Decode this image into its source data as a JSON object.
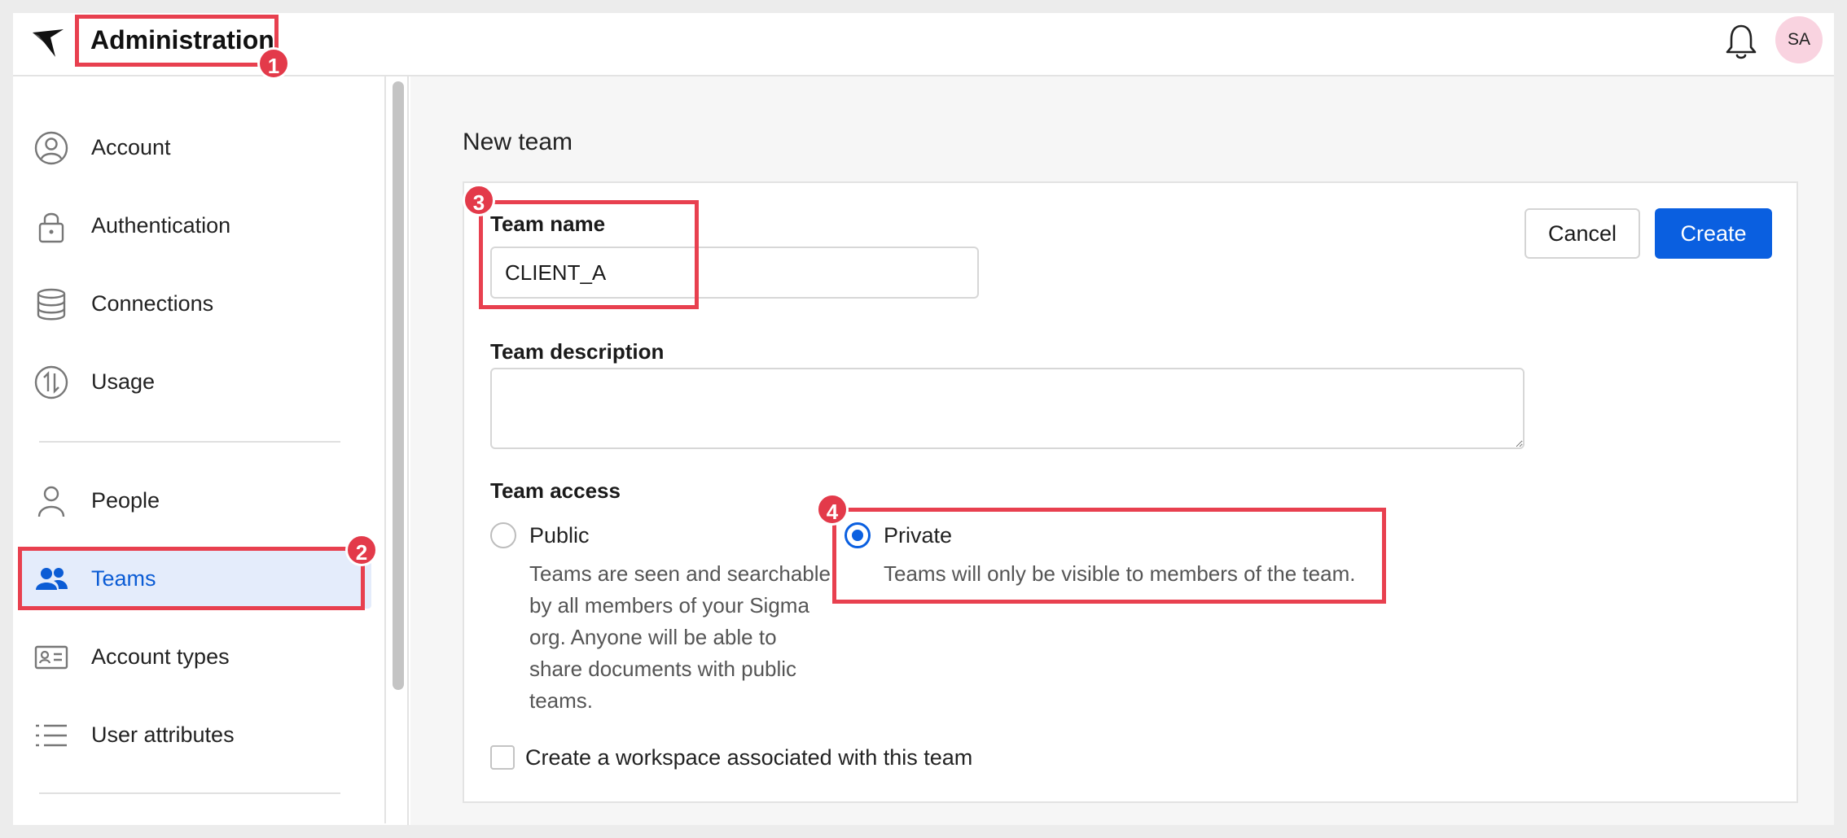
{
  "header": {
    "app_title": "Administration",
    "avatar_initials": "SA",
    "icons": [
      "sigma-logo",
      "bell-icon"
    ]
  },
  "sidebar": {
    "items": [
      {
        "label": "Account",
        "icon": "user-circle-icon"
      },
      {
        "label": "Authentication",
        "icon": "lock-icon"
      },
      {
        "label": "Connections",
        "icon": "database-icon"
      },
      {
        "label": "Usage",
        "icon": "usage-arrows-icon"
      },
      {
        "label": "People",
        "icon": "person-icon"
      },
      {
        "label": "Teams",
        "icon": "team-icon",
        "active": true
      },
      {
        "label": "Account types",
        "icon": "id-card-icon"
      },
      {
        "label": "User attributes",
        "icon": "list-icon"
      }
    ]
  },
  "main": {
    "page_title": "New team",
    "form": {
      "team_name_label": "Team name",
      "team_name_value": "CLIENT_A",
      "team_description_label": "Team description",
      "team_description_value": "",
      "team_access_label": "Team access",
      "options": [
        {
          "label": "Public",
          "description": "Teams are seen and searchable by all members of your Sigma org. Anyone will be able to share documents with public teams.",
          "selected": false
        },
        {
          "label": "Private",
          "description": "Teams will only be visible to members of the team.",
          "selected": true
        }
      ],
      "workspace_checkbox_label": "Create a workspace associated with this team",
      "workspace_checked": false
    },
    "buttons": {
      "cancel": "Cancel",
      "create": "Create"
    }
  },
  "annotations": [
    "1",
    "2",
    "3",
    "4"
  ],
  "colors": {
    "accent": "#0a5fe0",
    "highlight": "#e8404f",
    "active_bg": "#e4ecfb",
    "avatar_bg": "#f9d3e0"
  }
}
